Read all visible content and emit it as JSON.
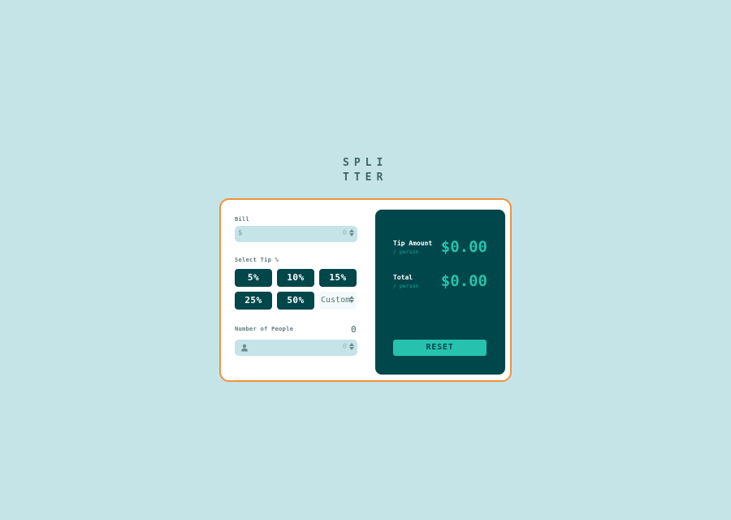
{
  "logo": {
    "line1": "SPLI",
    "line2": "TTER"
  },
  "bill": {
    "label": "Bill",
    "prefix": "$",
    "value": "0"
  },
  "tip": {
    "label": "Select Tip %",
    "options": [
      "5%",
      "10%",
      "15%",
      "25%",
      "50%"
    ],
    "custom_placeholder": "Custom"
  },
  "people": {
    "label": "Number of People",
    "count_display": "0",
    "value": "0",
    "icon": "person-icon"
  },
  "results": {
    "tip_amount_label": "Tip Amount",
    "tip_amount_sub": "/ person",
    "tip_amount_value": "$0.00",
    "total_label": "Total",
    "total_sub": "/ person",
    "total_value": "$0.00",
    "reset_label": "RESET"
  },
  "colors": {
    "background": "#c5e4e7",
    "primary_dark": "#00474b",
    "accent": "#26c2ad",
    "card_border": "#f0923b"
  }
}
